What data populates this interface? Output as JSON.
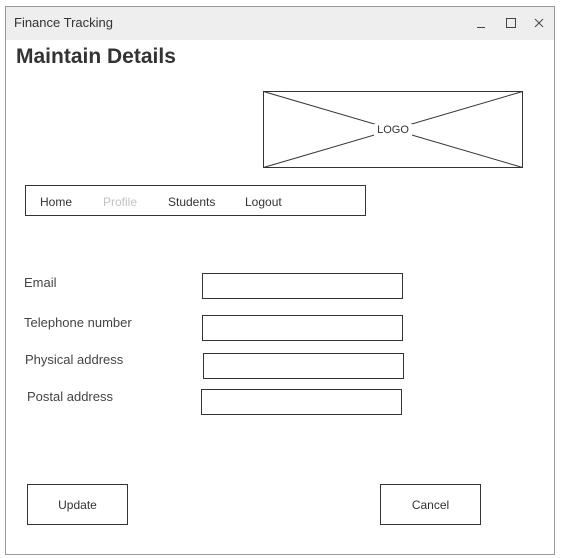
{
  "window": {
    "title": "Finance Tracking",
    "controls": [
      "minimize-icon",
      "maximize-icon",
      "close-icon"
    ]
  },
  "page": {
    "title": "Maintain Details"
  },
  "logo": {
    "label": "LOGO"
  },
  "nav": {
    "items": [
      {
        "label": "Home",
        "enabled": true
      },
      {
        "label": "Profile",
        "enabled": false
      },
      {
        "label": "Students",
        "enabled": true
      },
      {
        "label": "Logout",
        "enabled": true
      }
    ]
  },
  "form": {
    "fields": [
      {
        "label": "Email",
        "value": ""
      },
      {
        "label": "Telephone number",
        "value": ""
      },
      {
        "label": "Physical address",
        "value": ""
      },
      {
        "label": "Postal address",
        "value": ""
      }
    ]
  },
  "actions": {
    "update_label": "Update",
    "cancel_label": "Cancel"
  },
  "colors": {
    "titlebar": "#eeeeee",
    "border": "#333333",
    "disabled_text": "#c2c2c2"
  }
}
